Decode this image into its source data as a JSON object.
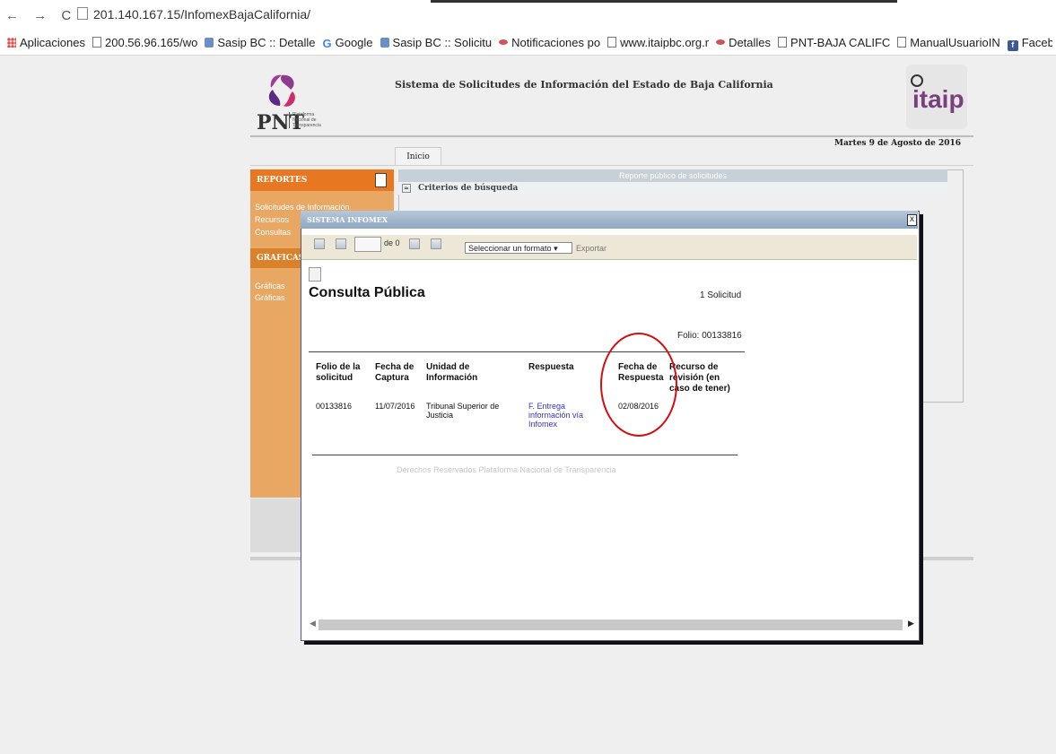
{
  "browser": {
    "nav_icons": "← → C",
    "url": "201.140.167.15/InfomexBajaCalifornia/",
    "bookmarks": [
      {
        "label": "Aplicaciones",
        "icon": "apps-grid-icon"
      },
      {
        "label": "200.56.96.165/wo",
        "icon": "page-icon"
      },
      {
        "label": "Sasip BC :: Detalle",
        "icon": "sasip-icon"
      },
      {
        "label": "Google",
        "icon": "google-icon"
      },
      {
        "label": "Sasip BC :: Solicitu",
        "icon": "sasip-icon"
      },
      {
        "label": "Notificaciones po",
        "icon": "itaip-icon"
      },
      {
        "label": "www.itaipbc.org.r",
        "icon": "page-icon"
      },
      {
        "label": "Detalles",
        "icon": "itaip-icon"
      },
      {
        "label": "PNT-BAJA CALIFC",
        "icon": "page-icon"
      },
      {
        "label": "ManualUsuarioIN",
        "icon": "page-icon"
      },
      {
        "label": "Facebook",
        "icon": "facebook-icon"
      }
    ]
  },
  "header": {
    "logo_text": "PNT",
    "logo_subtext": "Plataforma Nacional de Transparencia",
    "title": "Sistema de Solicitudes de Información del Estado de Baja California",
    "right_logo_text": "itaip",
    "date": "Martes 9 de Agosto de 2016",
    "tab": "Inicio"
  },
  "sidebar": {
    "reportes": "REPORTES",
    "items": [
      "Solicitudes de Información",
      "Recursos",
      "Consultas"
    ],
    "grafica": "GRAFICAS",
    "grafica_items": [
      "Gráficas",
      "Gráficas"
    ]
  },
  "content": {
    "header": "Reporte público de solicitudes",
    "criteria": "Criterios de búsqueda"
  },
  "modal": {
    "title": "SISTEMA INFOMEX",
    "close": "x",
    "toolbar": {
      "page_of": "de 0",
      "format_select": "Seleccionar un formato",
      "export": "Exportar"
    },
    "report_title": "Consulta Pública",
    "count": "1 Solicitud",
    "folio": "Folio: 00133816",
    "columns": {
      "folio_1": "Folio de la",
      "folio_2": "solicitud",
      "fecha_1": "Fecha de",
      "fecha_2": "Captura",
      "unidad_1": "Unidad de",
      "unidad_2": "Información",
      "respuesta": "Respuesta",
      "fresp_1": "Fecha de",
      "fresp_2": "Respuesta",
      "recurso_1": "Recurso de",
      "recurso_2": "revisión (en",
      "recurso_3": "caso de tener)"
    },
    "row": {
      "folio": "00133816",
      "fecha": "11/07/2016",
      "unidad_1": "Tribunal Superior de",
      "unidad_2": "Justicia",
      "respuesta_1": "F. Entrega",
      "respuesta_2": "información vía",
      "respuesta_3": "Infomex",
      "fecha_respuesta": "02/08/2016",
      "recurso": ""
    },
    "footer": "Derechos Reservados Plataforma Nacional de Transparencia"
  }
}
